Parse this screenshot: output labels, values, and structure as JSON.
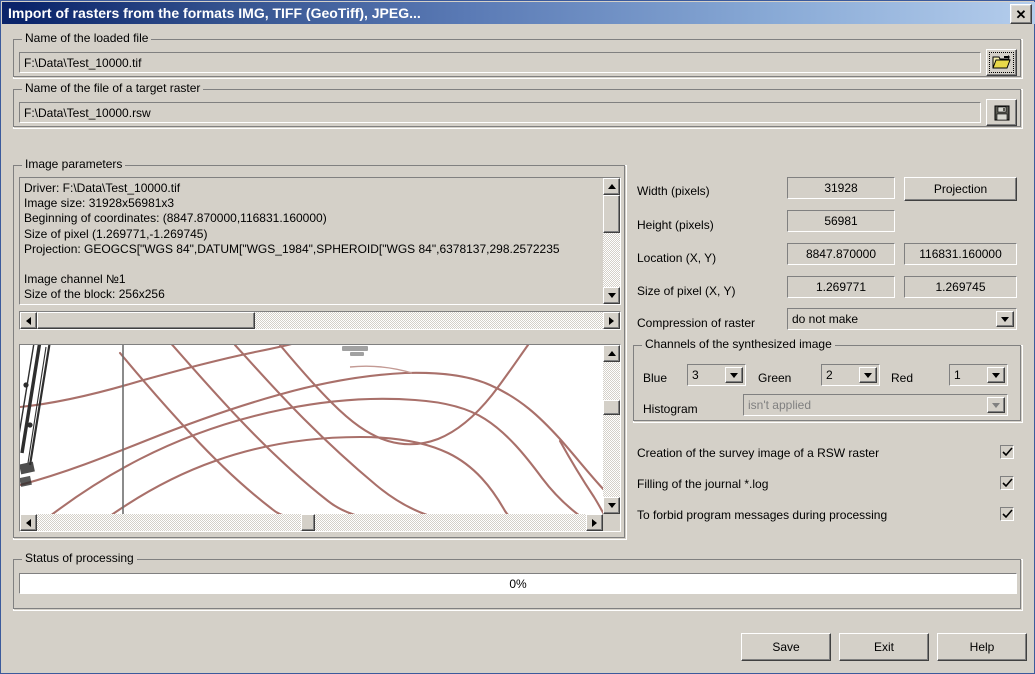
{
  "window": {
    "title": "Import of rasters from the formats IMG, TIFF (GeoTiff), JPEG...",
    "close_label": "✕",
    "titlebar_color_start": "#0a246a",
    "titlebar_color_end": "#b4cdec",
    "face_color": "#d4d0c8"
  },
  "loaded_file": {
    "group_label": "Name of the loaded file",
    "value": "F:\\Data\\Test_10000.tif",
    "browse_icon": "open-folder-icon"
  },
  "target_file": {
    "group_label": "Name of the file of a target raster",
    "value": "F:\\Data\\Test_10000.rsw",
    "save_icon": "floppy-disk-icon"
  },
  "image_parameters": {
    "group_label": "Image parameters",
    "lines": [
      "Driver: F:\\Data\\Test_10000.tif",
      "Image size: 31928x56981x3",
      "Beginning of coordinates: (8847.870000,116831.160000)",
      "Size of pixel (1.269771,-1.269745)",
      "Projection: GEOGCS[\"WGS 84\",DATUM[\"WGS_1984\",SPHEROID[\"WGS 84\",6378137,298.2572235",
      "",
      "Image channel №1",
      "Size of the block: 256x256"
    ]
  },
  "properties": {
    "width_label": "Width (pixels)",
    "width_value": "31928",
    "height_label": "Height (pixels)",
    "height_value": "56981",
    "location_label": "Location (X, Y)",
    "location_x": "8847.870000",
    "location_y": "116831.160000",
    "pixel_size_label": "Size of pixel (X, Y)",
    "pixel_size_x": "1.269771",
    "pixel_size_y": "1.269745",
    "compression_label": "Compression of raster",
    "compression_value": "do not make",
    "projection_button": "Projection"
  },
  "channels": {
    "group_label": "Channels of the synthesized image",
    "blue_label": "Blue",
    "blue_value": "3",
    "green_label": "Green",
    "green_value": "2",
    "red_label": "Red",
    "red_value": "1",
    "histogram_label": "Histogram",
    "histogram_value": "isn't applied"
  },
  "options": [
    {
      "label": "Creation of the survey image of a RSW raster",
      "checked": true
    },
    {
      "label": "Filling of the journal *.log",
      "checked": true
    },
    {
      "label": "To forbid program messages during processing",
      "checked": true
    }
  ],
  "status": {
    "group_label": "Status of processing",
    "progress_text": "0%",
    "progress_percent": 0
  },
  "footer": {
    "save_label": "Save",
    "exit_label": "Exit",
    "help_label": "Help"
  },
  "preview": {
    "description": "topographic map fragment with brown contour lines",
    "contour_color": "#a9706a",
    "road_color": "#2e2e2e",
    "grid_color": "#6e6e6e",
    "background": "#ffffff"
  }
}
